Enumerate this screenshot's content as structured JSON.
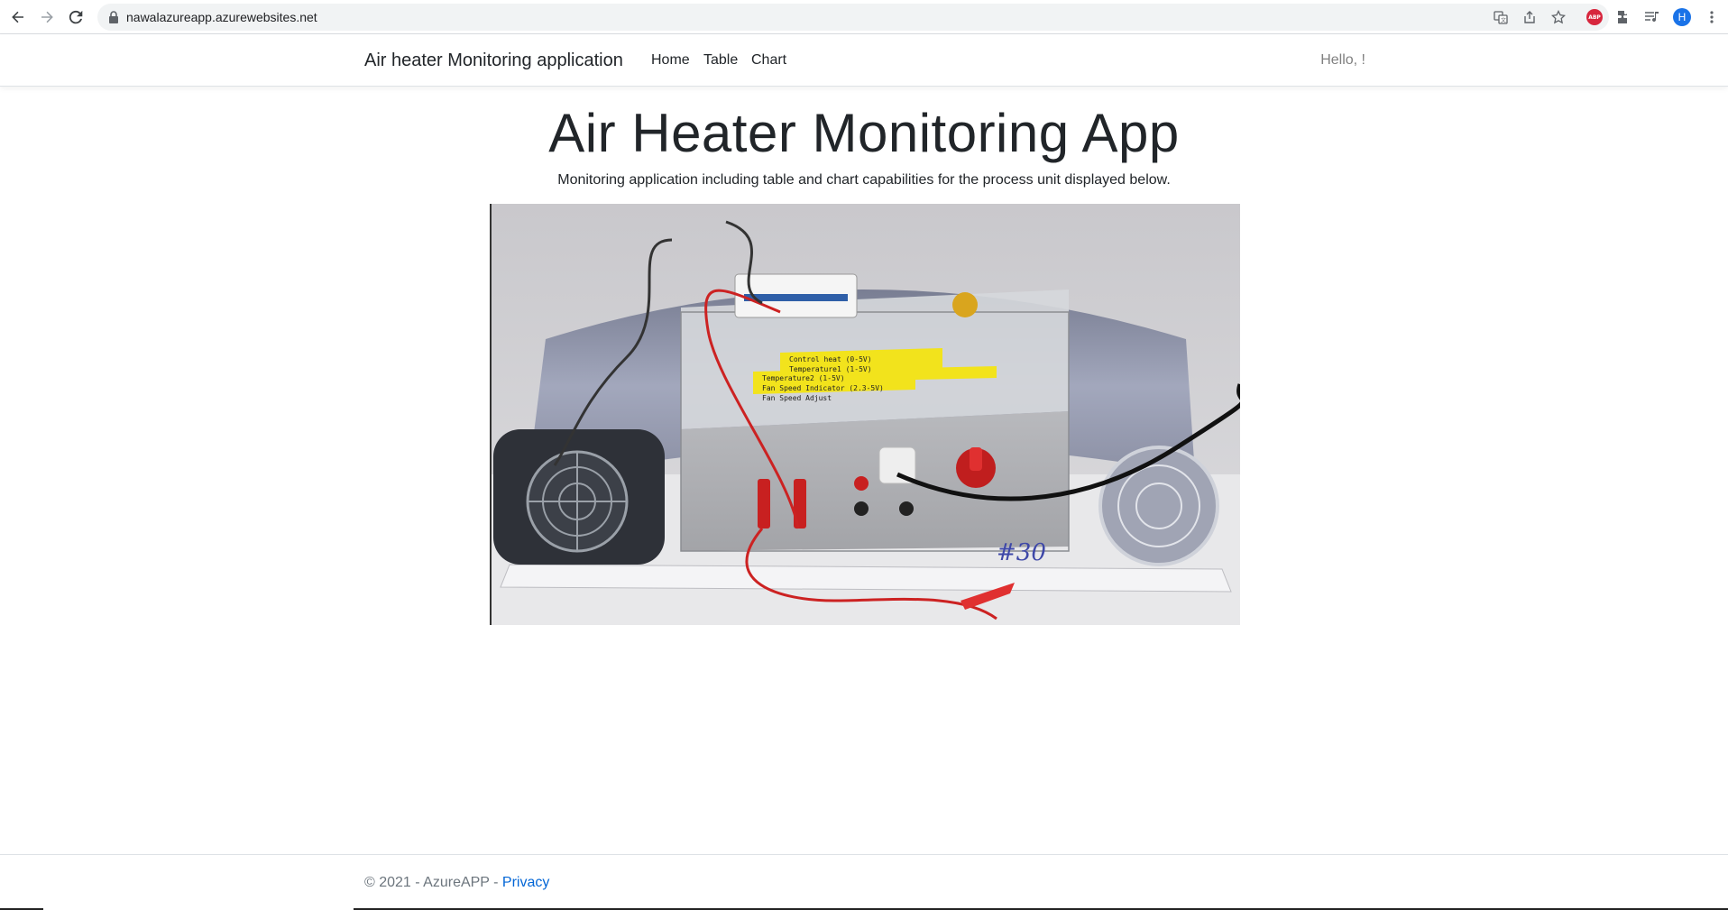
{
  "browser": {
    "url": "nawalazureapp.azurewebsites.net",
    "avatar_letter": "H",
    "abp_label": "ABP"
  },
  "navbar": {
    "brand": "Air heater Monitoring application",
    "links": [
      {
        "label": "Home"
      },
      {
        "label": "Table"
      },
      {
        "label": "Chart"
      }
    ],
    "greeting": "Hello, !"
  },
  "main": {
    "title": "Air Heater Monitoring App",
    "subtitle": "Monitoring application including table and chart capabilities for the process unit displayed below.",
    "photo": {
      "labels": [
        "Control heat (0-5V)",
        "Temperature1 (1-5V)",
        "Temperature2 (1-5V)",
        "Fan Speed Indicator (2.3-5V)",
        "Fan Speed Adjust"
      ],
      "unit_number": "#30"
    }
  },
  "footer": {
    "copyright": "© 2021 - AzureAPP - ",
    "privacy": "Privacy"
  }
}
